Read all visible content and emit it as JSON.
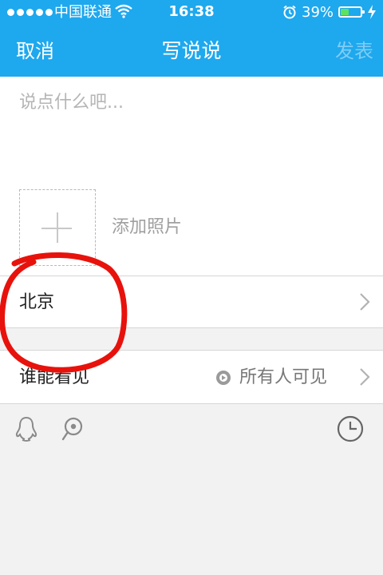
{
  "status_bar": {
    "carrier": "中国联通",
    "time": "16:38",
    "battery_percent": "39%"
  },
  "nav": {
    "cancel": "取消",
    "title": "写说说",
    "publish": "发表"
  },
  "compose": {
    "placeholder": "说点什么吧...",
    "add_photo": "添加照片"
  },
  "location": {
    "label": "北京"
  },
  "visibility": {
    "label": "谁能看见",
    "value": "所有人可见"
  },
  "toolbar": {
    "icons": [
      "qq-penguin-icon",
      "mention-at-icon",
      "clock-icon"
    ]
  },
  "colors": {
    "header_blue": "#1ea8ee",
    "publish_disabled": "#7fcdf5",
    "battery_green": "#5ee25e",
    "annotation_red": "#e8120c"
  }
}
